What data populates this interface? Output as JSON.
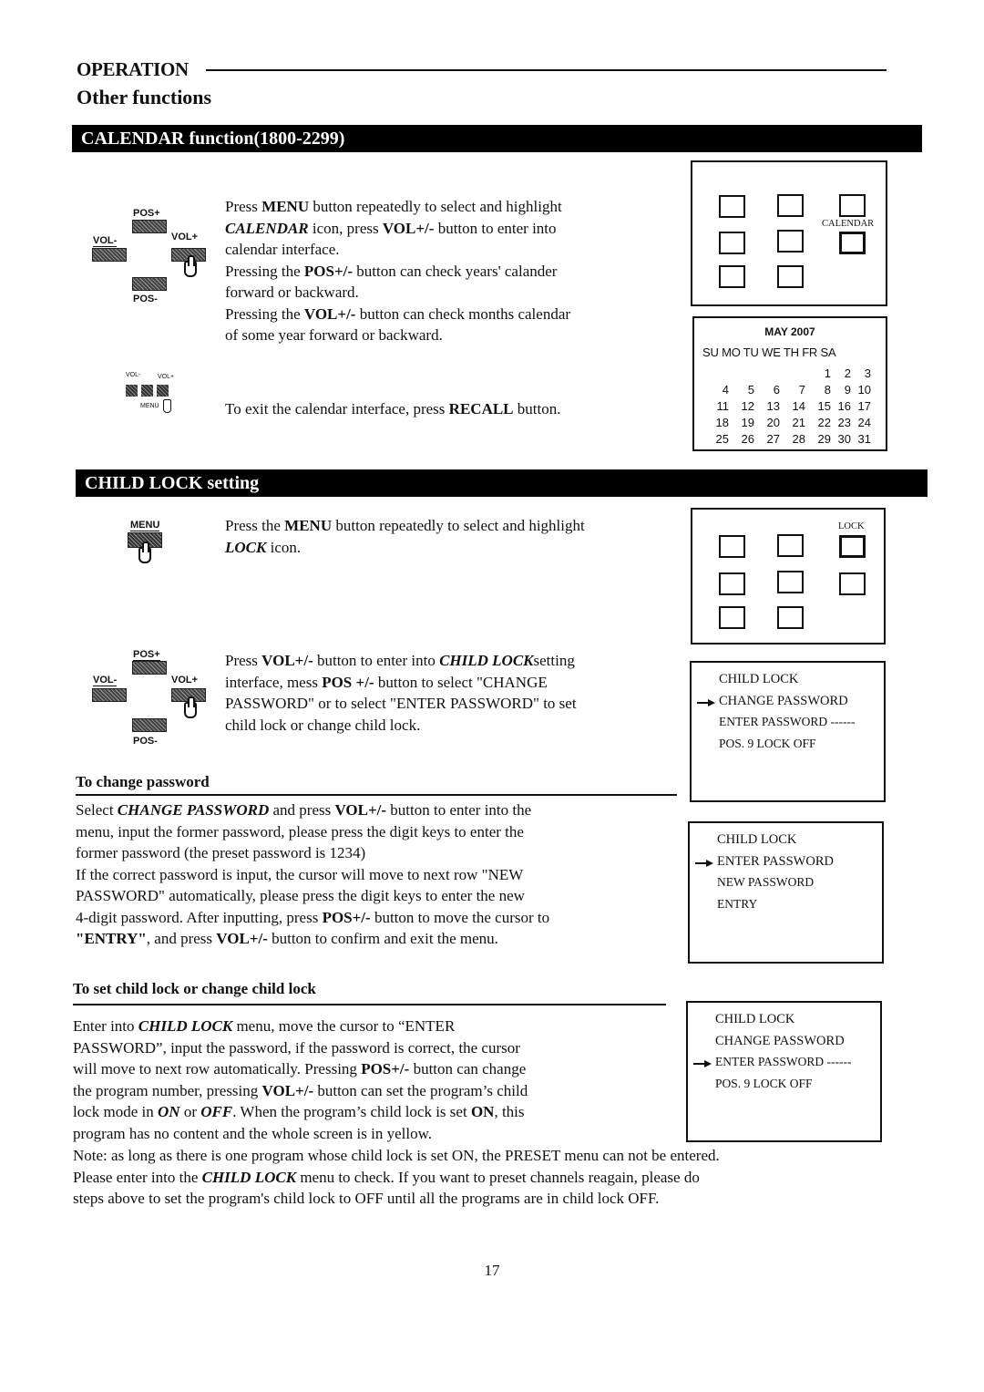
{
  "header": {
    "operation": "OPERATION",
    "subtitle": "Other functions"
  },
  "calendar_section": {
    "title": "CALENDAR function(1800-2299)",
    "remote_labels": {
      "pos_plus": "POS+",
      "pos_minus": "POS-",
      "vol_minus": "VOL-",
      "vol_plus": "VOL+"
    },
    "small_remote_labels": {
      "vol_minus": "VOL-",
      "vol_plus": "VOL+",
      "menu": "MENU"
    },
    "paragraph": [
      {
        "t": "Press "
      },
      {
        "t": "MENU",
        "b": true
      },
      {
        "t": " button repeatedly to select and highlight"
      },
      {
        "br": true
      },
      {
        "t": "CALENDAR",
        "b": true,
        "i": true
      },
      {
        "t": " icon, press "
      },
      {
        "t": "VOL+/-",
        "b": true
      },
      {
        "t": " button to enter into"
      },
      {
        "br": true
      },
      {
        "t": "calendar interface."
      },
      {
        "br": true
      },
      {
        "t": "Pressing the "
      },
      {
        "t": "POS+/-",
        "b": true
      },
      {
        "t": " button can check years' calander"
      },
      {
        "br": true
      },
      {
        "t": "forward or backward."
      },
      {
        "br": true
      },
      {
        "t": "Pressing the "
      },
      {
        "t": "VOL+/-",
        "b": true
      },
      {
        "t": " button can check months calendar"
      },
      {
        "br": true
      },
      {
        "t": "of some year forward or backward."
      }
    ],
    "exit_text": [
      {
        "t": "To exit the calendar interface, press "
      },
      {
        "t": "RECALL",
        "b": true
      },
      {
        "t": " button."
      }
    ],
    "menu_screen": {
      "highlight_label": "CALENDAR",
      "icon_count": 8
    },
    "calendar": {
      "title": "MAY 2007",
      "weekdays": [
        "SU",
        "MO",
        "TU",
        "WE",
        "TH",
        "FR",
        "SA"
      ],
      "weeks": [
        [
          "",
          "",
          "",
          "",
          "1",
          "2",
          "3"
        ],
        [
          "4",
          "5",
          "6",
          "7",
          "8",
          "9",
          "10"
        ],
        [
          "11",
          "12",
          "13",
          "14",
          "15",
          "16",
          "17"
        ],
        [
          "18",
          "19",
          "20",
          "21",
          "22",
          "23",
          "24"
        ],
        [
          "25",
          "26",
          "27",
          "28",
          "29",
          "30",
          "31"
        ]
      ]
    }
  },
  "child_lock_section": {
    "title": "CHILD LOCK setting",
    "menu_key_label": "MENU",
    "step1": [
      {
        "t": "Press the "
      },
      {
        "t": "MENU",
        "b": true
      },
      {
        "t": " button repeatedly to select and highlight"
      },
      {
        "br": true
      },
      {
        "t": "LOCK",
        "b": true,
        "i": true
      },
      {
        "t": " icon."
      }
    ],
    "lock_screen": {
      "highlight_label": "LOCK",
      "icon_count": 8
    },
    "remote_labels": {
      "pos_plus": "POS+",
      "pos_minus": "POS-",
      "vol_minus": "VOL-",
      "vol_plus": "VOL+"
    },
    "step2": [
      {
        "t": "Press "
      },
      {
        "t": "VOL+/-",
        "b": true
      },
      {
        "t": " button to enter into "
      },
      {
        "t": "CHILD LOCK",
        "b": true,
        "i": true
      },
      {
        "t": "setting"
      },
      {
        "br": true
      },
      {
        "t": "interface, mess "
      },
      {
        "t": "POS +/-",
        "b": true
      },
      {
        "t": " button to select \"CHANGE"
      },
      {
        "br": true
      },
      {
        "t": "PASSWORD\" or to select \"ENTER PASSWORD\" to set"
      },
      {
        "br": true
      },
      {
        "t": "child lock or change child lock."
      }
    ],
    "menu1": {
      "lines": [
        "CHILD LOCK",
        "CHANGE PASSWORD",
        "ENTER PASSWORD ------",
        "POS.    9    LOCK OFF"
      ],
      "cursor_index": 1
    },
    "change_password": {
      "heading": "To  change password",
      "body": [
        {
          "t": "Select "
        },
        {
          "t": "CHANGE PASSWORD",
          "b": true,
          "i": true
        },
        {
          "t": " and press "
        },
        {
          "t": "VOL+/-",
          "b": true
        },
        {
          "t": " button to enter into the"
        },
        {
          "br": true
        },
        {
          "t": "menu, input the former password, please press the digit keys to enter the"
        },
        {
          "br": true
        },
        {
          "t": "former password (the preset password is 1234)"
        },
        {
          "br": true
        },
        {
          "t": "If the correct password is input, the cursor will move to next row \"NEW"
        },
        {
          "br": true
        },
        {
          "t": "PASSWORD\" automatically, please press the digit keys to enter the new"
        },
        {
          "br": true
        },
        {
          "t": "4-digit password. After inputting, press "
        },
        {
          "t": "POS+/-",
          "b": true
        },
        {
          "t": " button to move the cursor to"
        },
        {
          "br": true
        },
        {
          "t": "\"ENTRY\"",
          "b": true
        },
        {
          "t": ", and press "
        },
        {
          "t": "VOL+/-",
          "b": true
        },
        {
          "t": " button to confirm and exit the menu."
        }
      ]
    },
    "menu2": {
      "lines": [
        "CHILD LOCK",
        "ENTER PASSWORD",
        "NEW PASSWORD",
        "ENTRY"
      ],
      "cursor_index": 1
    },
    "set_child_lock": {
      "heading": "To set child lock or change child lock",
      "body": [
        {
          "t": "Enter into "
        },
        {
          "t": "CHILD LOCK",
          "b": true,
          "i": true
        },
        {
          "t": " menu, move the cursor to “ENTER"
        },
        {
          "br": true
        },
        {
          "t": "PASSWORD”, input the password, if the password is correct, the cursor"
        },
        {
          "br": true
        },
        {
          "t": "will move to next row automatically. Pressing "
        },
        {
          "t": "POS+/-",
          "b": true
        },
        {
          "t": " button can change"
        },
        {
          "br": true
        },
        {
          "t": "the program number, pressing "
        },
        {
          "t": "VOL+/-",
          "b": true
        },
        {
          "t": " button can set the program’s child"
        },
        {
          "br": true
        },
        {
          "t": "lock mode in "
        },
        {
          "t": "ON",
          "b": true,
          "i": true
        },
        {
          "t": " or "
        },
        {
          "t": "OFF",
          "b": true,
          "i": true
        },
        {
          "t": ". When the program’s child lock is set "
        },
        {
          "t": "ON",
          "b": true
        },
        {
          "t": ", this"
        },
        {
          "br": true
        },
        {
          "t": "program has no content and the whole screen is in yellow."
        }
      ]
    },
    "menu3": {
      "lines": [
        "CHILD LOCK",
        "CHANGE PASSWORD",
        "ENTER PASSWORD ------",
        "POS.    9    LOCK OFF"
      ],
      "cursor_index": 2
    },
    "note": [
      {
        "t": "Note: as long as there is one program whose child lock is set ON, the PRESET menu can not be entered."
      },
      {
        "br": true
      },
      {
        "t": "Please enter into the "
      },
      {
        "t": "CHILD LOCK",
        "b": true,
        "i": true
      },
      {
        "t": " menu to check. If you want to preset channels reagain, please do"
      },
      {
        "br": true
      },
      {
        "t": "steps above to set the program's child lock to OFF until all the programs are in child lock OFF."
      }
    ]
  },
  "page_number": "17"
}
